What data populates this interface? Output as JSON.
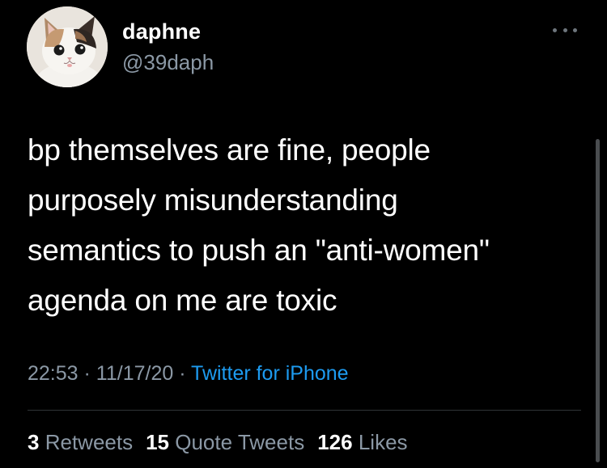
{
  "author": {
    "display_name": "daphne",
    "handle": "@39daph",
    "avatar_icon": "cat-avatar"
  },
  "tweet": {
    "text": "bp themselves are fine, people\npurposely misunderstanding\nsemantics to push an \"anti-women\"\nagenda on me are toxic",
    "time": "22:53",
    "date": "11/17/20",
    "separator": "·",
    "source": "Twitter for iPhone"
  },
  "stats": {
    "retweets_count": "3",
    "retweets_label": "Retweets",
    "quote_tweets_count": "15",
    "quote_tweets_label": "Quote Tweets",
    "likes_count": "126",
    "likes_label": "Likes"
  },
  "colors": {
    "background": "#000000",
    "primary_text": "#ffffff",
    "secondary_text": "#8b98a5",
    "link": "#1d9bf0",
    "divider": "#2f3336"
  },
  "icons": [
    "cat-avatar",
    "more-options-icon"
  ]
}
